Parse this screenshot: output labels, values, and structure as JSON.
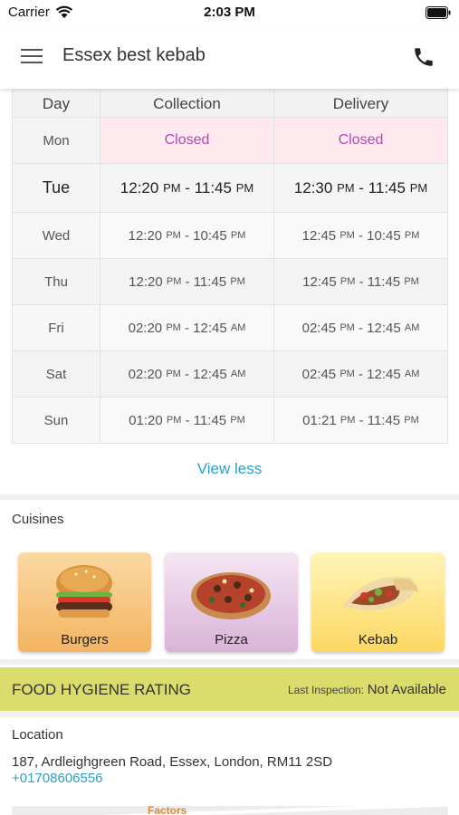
{
  "status_bar": {
    "carrier": "Carrier",
    "time": "2:03 PM"
  },
  "header": {
    "title": "Essex best kebab"
  },
  "hours": {
    "headers": {
      "day": "Day",
      "collection": "Collection",
      "delivery": "Delivery"
    },
    "rows": [
      {
        "day": "Mon",
        "closed": true,
        "collection": "Closed",
        "delivery": "Closed"
      },
      {
        "day": "Tue",
        "today": true,
        "collection": {
          "open": "12:20",
          "open_ampm": "PM",
          "close": "11:45",
          "close_ampm": "PM"
        },
        "delivery": {
          "open": "12:30",
          "open_ampm": "PM",
          "close": "11:45",
          "close_ampm": "PM"
        }
      },
      {
        "day": "Wed",
        "collection": {
          "open": "12:20",
          "open_ampm": "PM",
          "close": "10:45",
          "close_ampm": "PM"
        },
        "delivery": {
          "open": "12:45",
          "open_ampm": "PM",
          "close": "10:45",
          "close_ampm": "PM"
        }
      },
      {
        "day": "Thu",
        "collection": {
          "open": "12:20",
          "open_ampm": "PM",
          "close": "11:45",
          "close_ampm": "PM"
        },
        "delivery": {
          "open": "12:45",
          "open_ampm": "PM",
          "close": "11:45",
          "close_ampm": "PM"
        }
      },
      {
        "day": "Fri",
        "collection": {
          "open": "02:20",
          "open_ampm": "PM",
          "close": "12:45",
          "close_ampm": "AM"
        },
        "delivery": {
          "open": "02:45",
          "open_ampm": "PM",
          "close": "12:45",
          "close_ampm": "AM"
        }
      },
      {
        "day": "Sat",
        "collection": {
          "open": "02:20",
          "open_ampm": "PM",
          "close": "12:45",
          "close_ampm": "AM"
        },
        "delivery": {
          "open": "02:45",
          "open_ampm": "PM",
          "close": "12:45",
          "close_ampm": "AM"
        }
      },
      {
        "day": "Sun",
        "collection": {
          "open": "01:20",
          "open_ampm": "PM",
          "close": "11:45",
          "close_ampm": "PM"
        },
        "delivery": {
          "open": "01:21",
          "open_ampm": "PM",
          "close": "11:45",
          "close_ampm": "PM"
        }
      }
    ],
    "view_less_label": "View less"
  },
  "cuisines": {
    "label": "Cuisines",
    "items": [
      {
        "name": "Burgers",
        "icon": "burger-image"
      },
      {
        "name": "Pizza",
        "icon": "pizza-image"
      },
      {
        "name": "Kebab",
        "icon": "kebab-image"
      }
    ]
  },
  "hygiene": {
    "title": "Food Hygiene Rating",
    "inspection_label": "Last Inspection:",
    "inspection_value": "Not Available"
  },
  "location": {
    "label": "Location",
    "address": "187, Ardleighgreen Road, Essex, London, RM11 2SD",
    "phone": "+01708606556",
    "map_label": "Factors"
  },
  "colors": {
    "accent": "#2a9fc7",
    "closed_text": "#b64bb4",
    "closed_bg": "#fde9ee",
    "hygiene_bg": "#dadd6b"
  }
}
